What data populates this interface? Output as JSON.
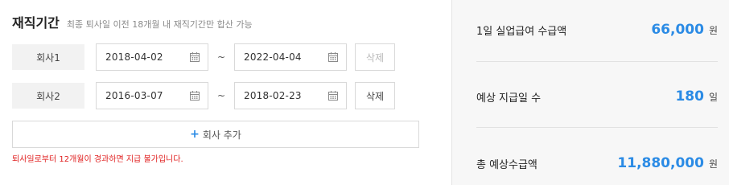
{
  "header": {
    "title": "재직기간",
    "subtitle": "최종 퇴사일 이전 18개월 내 재직기간만 합산 가능"
  },
  "rows": [
    {
      "company": "회사1",
      "start": "2018-04-02",
      "end": "2022-04-04",
      "delete_label": "삭제",
      "delete_enabled": false
    },
    {
      "company": "회사2",
      "start": "2016-03-07",
      "end": "2018-02-23",
      "delete_label": "삭제",
      "delete_enabled": true
    }
  ],
  "separator": "~",
  "add_button": {
    "icon": "+",
    "label": "회사 추가"
  },
  "error_message": "퇴사일로부터 12개월이 경과하면 지급 불가입니다.",
  "results": [
    {
      "label": "1일 실업급여 수급액",
      "value": "66,000",
      "unit": "원"
    },
    {
      "label": "예상 지급일 수",
      "value": "180",
      "unit": "일"
    },
    {
      "label": "총 예상수급액",
      "value": "11,880,000",
      "unit": "원"
    }
  ],
  "colors": {
    "accent": "#2b8be5",
    "error": "#e02020",
    "panel_bg": "#f7f7f7"
  },
  "icons": {
    "date_picker": "calendar-icon",
    "add": "plus-icon"
  }
}
